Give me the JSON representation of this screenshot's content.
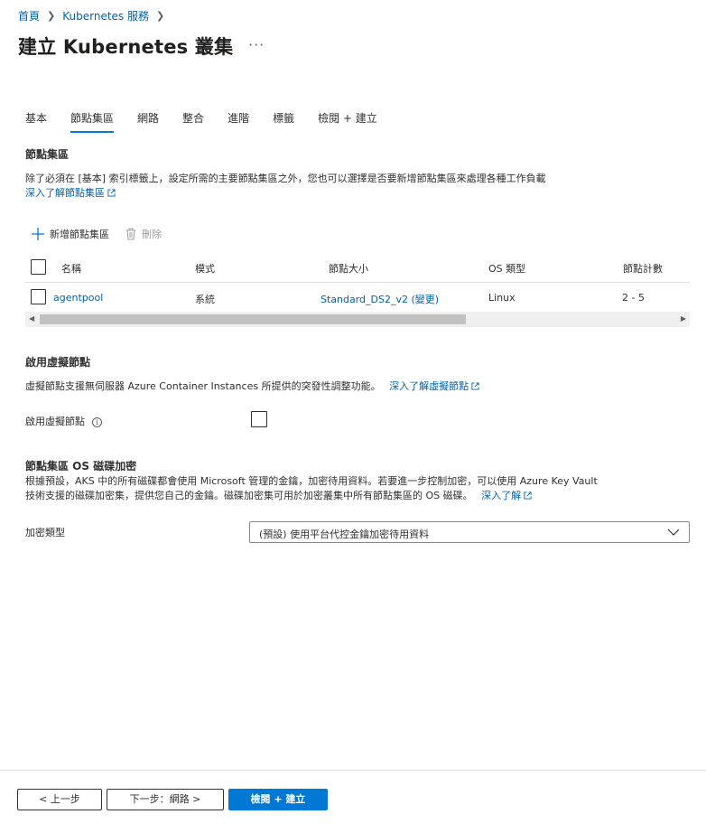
{
  "breadcrumb": {
    "home": "首頁",
    "service": "Kubernetes 服務"
  },
  "page": {
    "title": "建立 Kubernetes 叢集",
    "more": "···"
  },
  "tabs": [
    {
      "label": "基本",
      "active": false
    },
    {
      "label": "節點集區",
      "active": true
    },
    {
      "label": "網路",
      "active": false
    },
    {
      "label": "整合",
      "active": false
    },
    {
      "label": "進階",
      "active": false
    },
    {
      "label": "標籤",
      "active": false
    },
    {
      "label": "檢閱 + 建立",
      "active": false
    }
  ],
  "node_pools": {
    "title": "節點集區",
    "description": "除了必須在 [基本] 索引標籤上，設定所需的主要節點集區之外，您也可以選擇是否要新增節點集區來處理各種工作負載",
    "learn_more": "深入了解節點集區",
    "toolbar": {
      "add": "新增節點集區",
      "delete": "刪除"
    },
    "columns": [
      "名稱",
      "模式",
      "節點大小",
      "OS 類型",
      "節點計數"
    ],
    "rows": [
      {
        "name": "agentpool",
        "mode": "系統",
        "size": "Standard_DS2_v2 (變更)",
        "os": "Linux",
        "count": "2 - 5"
      }
    ]
  },
  "virtual_nodes": {
    "title": "啟用虛擬節點",
    "description": "虛擬節點支援無伺服器 Azure Container Instances 所提供的突發性調整功能。",
    "learn_more": "深入了解虛擬節點",
    "field_label": "啟用虛擬節點",
    "info": "i"
  },
  "encryption": {
    "title": "節點集區 OS 磁碟加密",
    "description_line1": "根據預設，AKS 中的所有磁碟都會使用 Microsoft 管理的金鑰，加密待用資料。若要進一步控制加密，可以使用 Azure Key Vault",
    "description_line2": "技術支援的磁碟加密集，提供您自己的金鑰。磁碟加密集可用於加密叢集中所有節點集區的 OS 磁碟。",
    "learn_more": "深入了解",
    "field_label": "加密類型",
    "selected": "(預設) 使用平台代控金鑰加密待用資料"
  },
  "footer": {
    "prev": "< 上一步",
    "next": "下一步：網路 >",
    "review": "檢閱 + 建立"
  },
  "colors": {
    "accent": "#0078d4",
    "link": "#0062ad",
    "text": "#323130"
  }
}
